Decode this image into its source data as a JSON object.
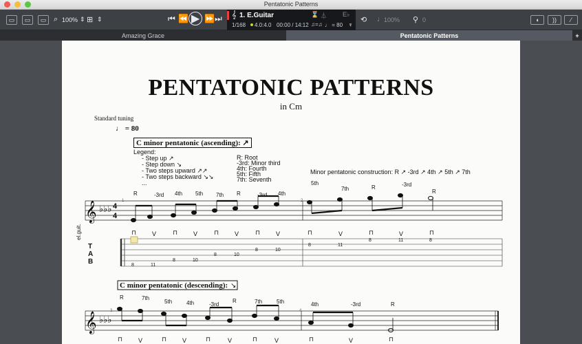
{
  "window": {
    "title": "Pentatonic Patterns"
  },
  "toolbar": {
    "zoom": "100%",
    "track_name": "1. E.Guitar",
    "bar_position": "1/168",
    "time_signature": "4.0:4.0",
    "time": "00:00 / 14:12",
    "tempo": "♩ = 80",
    "note_value": "♫=♫",
    "key_display": "E♭",
    "volume": "100%",
    "capo": "0"
  },
  "tabs": [
    {
      "label": "Amazing Grace",
      "active": false
    },
    {
      "label": "Pentatonic Patterns",
      "active": true
    }
  ],
  "score": {
    "title": "PENTATONIC PATTERNS",
    "subtitle": "in Cm",
    "tuning": "Standard tuning",
    "tempo_marking": "= 80",
    "instrument_label": "el.guit.",
    "section1": "C minor pentatonic (ascending):",
    "section2": "C minor pentatonic (descending):",
    "legend_title": "Legend:",
    "legend_items": [
      "- Step up",
      "- Step down",
      "- Two steps upward",
      "- Two steps backward",
      "..."
    ],
    "legend_intervals": [
      "R: Root",
      "-3rd: Minor third",
      "4th: Fourth",
      "5th: Fifth",
      "7th: Seventh"
    ],
    "construction": "Minor pentatonic construction: R ↗ -3rd ↗ 4th ↗ 5th ↗ 7th",
    "row1_labels": [
      "R",
      "-3rd",
      "4th",
      "5th",
      "7th",
      "R",
      "-3rd",
      "4th",
      "5th",
      "7th",
      "R",
      "-3rd",
      "R"
    ],
    "row1_tab": [
      "8",
      "11",
      "8",
      "10",
      "8",
      "10",
      "8",
      "10",
      "8",
      "11",
      "8",
      "11",
      "8"
    ],
    "row2_labels": [
      "R",
      "7th",
      "5th",
      "4th",
      "-3rd",
      "R",
      "7th",
      "5th",
      "4th",
      "-3rd",
      "R"
    ],
    "measure_numbers": [
      "1",
      "2",
      "3",
      "4"
    ]
  }
}
